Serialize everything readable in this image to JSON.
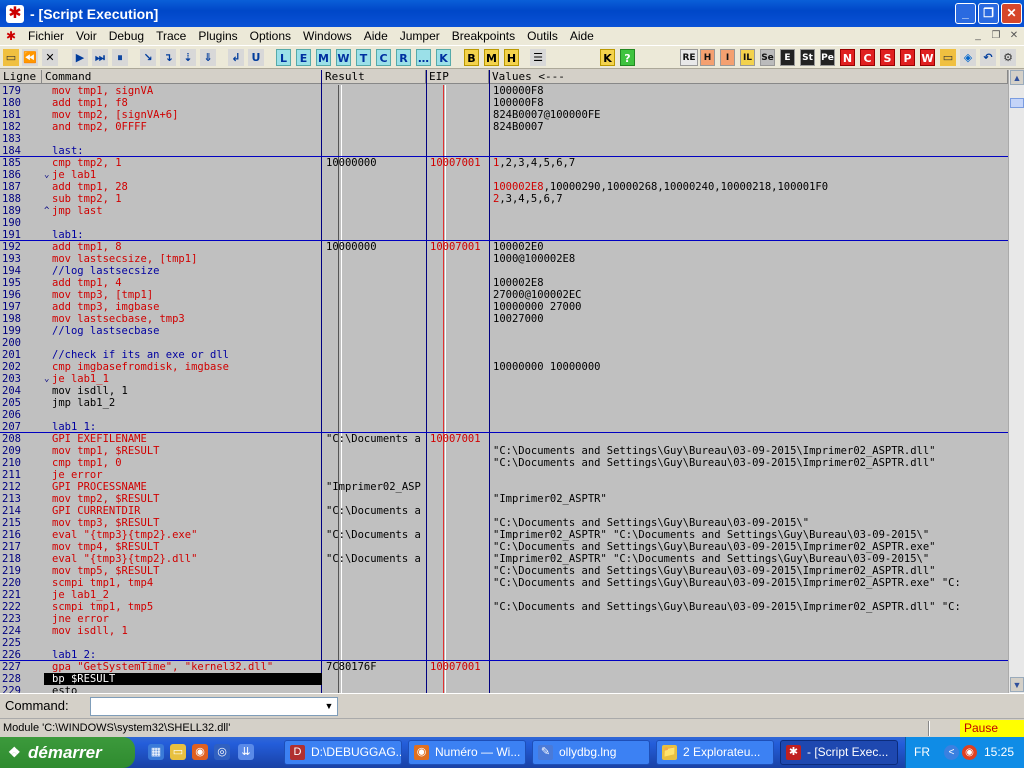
{
  "window": {
    "title": "- [Script Execution]",
    "min": "_",
    "restore": "❐",
    "close": "✕"
  },
  "menu": [
    "Fichier",
    "Voir",
    "Debug",
    "Trace",
    "Plugins",
    "Options",
    "Windows",
    "Aide",
    "Jumper",
    "Breakpoints",
    "Outils",
    "Aide"
  ],
  "toolbar": {
    "nav": [
      "⏩",
      "⏪",
      "✕",
      "▶",
      "⏭",
      "⏸",
      "↘",
      "↴",
      "⇣",
      "⇓",
      "↲",
      "U"
    ],
    "letters": [
      "L",
      "E",
      "M",
      "W",
      "T",
      "C",
      "R",
      "…",
      "K"
    ],
    "ylw": [
      "B",
      "M",
      "H"
    ],
    "right": [
      "RE",
      "H",
      "I",
      "IL",
      "Se",
      "E",
      "St",
      "Pe",
      "N",
      "C",
      "S",
      "P",
      "W"
    ]
  },
  "columns": {
    "line": "Ligne",
    "command": "Command",
    "result": "Result",
    "eip": "EIP",
    "values": "Values <---"
  },
  "rows": [
    {
      "n": "179",
      "c": "mov tmp1, signVA",
      "col": "red",
      "r": "",
      "e": "",
      "v": "100000F8"
    },
    {
      "n": "180",
      "c": "add tmp1, f8",
      "col": "red",
      "r": "",
      "e": "",
      "v": "100000F8"
    },
    {
      "n": "181",
      "c": "mov tmp2, [signVA+6]",
      "col": "red",
      "r": "",
      "e": "",
      "v": "824B0007@100000FE"
    },
    {
      "n": "182",
      "c": "and tmp2, 0FFFF",
      "col": "red",
      "r": "",
      "e": "",
      "v": "824B0007"
    },
    {
      "n": "183",
      "c": "",
      "col": "blk",
      "r": "",
      "e": "",
      "v": ""
    },
    {
      "n": "184",
      "c": "last:",
      "col": "blu",
      "r": "",
      "e": "",
      "v": "",
      "sep": true
    },
    {
      "n": "185",
      "c": "cmp tmp2, 1",
      "col": "red",
      "r": "10000000",
      "e": "10007001",
      "v": "1,2,3,4,5,6,7",
      "vred": "1"
    },
    {
      "n": "186",
      "c": "je lab1",
      "col": "red",
      "r": "",
      "e": "",
      "v": "",
      "mk": "⌄"
    },
    {
      "n": "187",
      "c": "add tmp1, 28",
      "col": "red",
      "r": "",
      "e": "",
      "v": "100002E8,10000290,10000268,10000240,10000218,100001F0",
      "vred": "100002E8"
    },
    {
      "n": "188",
      "c": "sub tmp2, 1",
      "col": "red",
      "r": "",
      "e": "",
      "v": "2,3,4,5,6,7",
      "vred": "2"
    },
    {
      "n": "189",
      "c": "jmp last",
      "col": "red",
      "r": "",
      "e": "",
      "v": "",
      "mk": "^"
    },
    {
      "n": "190",
      "c": "",
      "col": "blk",
      "r": "",
      "e": "",
      "v": ""
    },
    {
      "n": "191",
      "c": "lab1:",
      "col": "blu",
      "r": "",
      "e": "",
      "v": "",
      "sep": true
    },
    {
      "n": "192",
      "c": "add tmp1, 8",
      "col": "red",
      "r": "10000000",
      "e": "10007001",
      "v": "100002E0"
    },
    {
      "n": "193",
      "c": "mov lastsecsize, [tmp1]",
      "col": "red",
      "r": "",
      "e": "",
      "v": "1000@100002E8"
    },
    {
      "n": "194",
      "c": "//log lastsecsize",
      "col": "blu",
      "r": "",
      "e": "",
      "v": ""
    },
    {
      "n": "195",
      "c": "add tmp1, 4",
      "col": "red",
      "r": "",
      "e": "",
      "v": "100002E8"
    },
    {
      "n": "196",
      "c": "mov tmp3, [tmp1]",
      "col": "red",
      "r": "",
      "e": "",
      "v": "27000@100002EC"
    },
    {
      "n": "197",
      "c": "add tmp3, imgbase",
      "col": "red",
      "r": "",
      "e": "",
      "v": "10000000 27000"
    },
    {
      "n": "198",
      "c": "mov lastsecbase, tmp3",
      "col": "red",
      "r": "",
      "e": "",
      "v": "10027000"
    },
    {
      "n": "199",
      "c": "//log lastsecbase",
      "col": "blu",
      "r": "",
      "e": "",
      "v": ""
    },
    {
      "n": "200",
      "c": "",
      "col": "blk",
      "r": "",
      "e": "",
      "v": ""
    },
    {
      "n": "201",
      "c": "//check if its an exe or dll",
      "col": "blu",
      "r": "",
      "e": "",
      "v": ""
    },
    {
      "n": "202",
      "c": "cmp imgbasefromdisk, imgbase",
      "col": "red",
      "r": "",
      "e": "",
      "v": "10000000 10000000"
    },
    {
      "n": "203",
      "c": "je lab1_1",
      "col": "red",
      "r": "",
      "e": "",
      "v": "",
      "mk": "⌄"
    },
    {
      "n": "204",
      "c": "mov isdll, 1",
      "col": "blk",
      "r": "",
      "e": "",
      "v": ""
    },
    {
      "n": "205",
      "c": "jmp lab1_2",
      "col": "blk",
      "r": "",
      "e": "",
      "v": ""
    },
    {
      "n": "206",
      "c": "",
      "col": "blk",
      "r": "",
      "e": "",
      "v": ""
    },
    {
      "n": "207",
      "c": "lab1_1:",
      "col": "blu",
      "r": "",
      "e": "",
      "v": "",
      "sep": true
    },
    {
      "n": "208",
      "c": "GPI EXEFILENAME",
      "col": "red",
      "r": "\"C:\\Documents a",
      "e": "10007001",
      "v": ""
    },
    {
      "n": "209",
      "c": "mov tmp1, $RESULT",
      "col": "red",
      "r": "",
      "e": "",
      "v": "\"C:\\Documents and Settings\\Guy\\Bureau\\03-09-2015\\Imprimer02_ASPTR.dll\""
    },
    {
      "n": "210",
      "c": "cmp tmp1, 0",
      "col": "red",
      "r": "",
      "e": "",
      "v": "\"C:\\Documents and Settings\\Guy\\Bureau\\03-09-2015\\Imprimer02_ASPTR.dll\""
    },
    {
      "n": "211",
      "c": "je error",
      "col": "red",
      "r": "",
      "e": "",
      "v": ""
    },
    {
      "n": "212",
      "c": "GPI PROCESSNAME",
      "col": "red",
      "r": "\"Imprimer02_ASP",
      "e": "",
      "v": ""
    },
    {
      "n": "213",
      "c": "mov tmp2, $RESULT",
      "col": "red",
      "r": "",
      "e": "",
      "v": "\"Imprimer02_ASPTR\""
    },
    {
      "n": "214",
      "c": "GPI CURRENTDIR",
      "col": "red",
      "r": "\"C:\\Documents a",
      "e": "",
      "v": ""
    },
    {
      "n": "215",
      "c": "mov tmp3, $RESULT",
      "col": "red",
      "r": "",
      "e": "",
      "v": "\"C:\\Documents and Settings\\Guy\\Bureau\\03-09-2015\\\""
    },
    {
      "n": "216",
      "c": "eval \"{tmp3}{tmp2}.exe\"",
      "col": "red",
      "r": "\"C:\\Documents a",
      "e": "",
      "v": "\"Imprimer02_ASPTR\" \"C:\\Documents and Settings\\Guy\\Bureau\\03-09-2015\\\""
    },
    {
      "n": "217",
      "c": "mov tmp4, $RESULT",
      "col": "red",
      "r": "",
      "e": "",
      "v": "\"C:\\Documents and Settings\\Guy\\Bureau\\03-09-2015\\Imprimer02_ASPTR.exe\""
    },
    {
      "n": "218",
      "c": "eval \"{tmp3}{tmp2}.dll\"",
      "col": "red",
      "r": "\"C:\\Documents a",
      "e": "",
      "v": "\"Imprimer02_ASPTR\" \"C:\\Documents and Settings\\Guy\\Bureau\\03-09-2015\\\""
    },
    {
      "n": "219",
      "c": "mov tmp5, $RESULT",
      "col": "red",
      "r": "",
      "e": "",
      "v": "\"C:\\Documents and Settings\\Guy\\Bureau\\03-09-2015\\Imprimer02_ASPTR.dll\""
    },
    {
      "n": "220",
      "c": "scmpi tmp1, tmp4",
      "col": "red",
      "r": "",
      "e": "",
      "v": "\"C:\\Documents and Settings\\Guy\\Bureau\\03-09-2015\\Imprimer02_ASPTR.exe\" \"C:"
    },
    {
      "n": "221",
      "c": "je lab1_2",
      "col": "red",
      "r": "",
      "e": "",
      "v": ""
    },
    {
      "n": "222",
      "c": "scmpi tmp1, tmp5",
      "col": "red",
      "r": "",
      "e": "",
      "v": "\"C:\\Documents and Settings\\Guy\\Bureau\\03-09-2015\\Imprimer02_ASPTR.dll\" \"C:"
    },
    {
      "n": "223",
      "c": "jne error",
      "col": "red",
      "r": "",
      "e": "",
      "v": ""
    },
    {
      "n": "224",
      "c": "mov isdll, 1",
      "col": "red",
      "r": "",
      "e": "",
      "v": ""
    },
    {
      "n": "225",
      "c": "",
      "col": "blk",
      "r": "",
      "e": "",
      "v": ""
    },
    {
      "n": "226",
      "c": "lab1_2:",
      "col": "blu",
      "r": "",
      "e": "",
      "v": "",
      "sep": true
    },
    {
      "n": "227",
      "c": "gpa \"GetSystemTime\", \"kernel32.dll\"",
      "col": "red",
      "r": "7C80176F",
      "e": "10007001",
      "v": ""
    },
    {
      "n": "228",
      "c": "bp $RESULT",
      "col": "blk",
      "r": "",
      "e": "",
      "v": "",
      "sel": true
    },
    {
      "n": "229",
      "c": "esto",
      "col": "blk",
      "r": "",
      "e": "",
      "v": ""
    }
  ],
  "command": {
    "label": "Command:",
    "value": "",
    "dropdown": "▼"
  },
  "status": {
    "text": "Module 'C:\\WINDOWS\\system32\\SHELL32.dll'",
    "state": "Pause"
  },
  "taskbar": {
    "start": "démarrer",
    "tasks": [
      {
        "label": "D:\\DEBUGGAG...",
        "icon": "D",
        "iconColor": "#b03030"
      },
      {
        "label": "Numéro — Wi...",
        "icon": "◉",
        "iconColor": "#e07020"
      },
      {
        "label": "ollydbg.lng",
        "icon": "✎",
        "iconColor": "#4a7ad8"
      },
      {
        "label": "2 Explorateu...",
        "icon": "📁",
        "iconColor": "#e8c040"
      },
      {
        "label": "- [Script Exec...",
        "icon": "✱",
        "iconColor": "#c02020"
      }
    ],
    "lang": "FR",
    "clock": "15:25"
  }
}
